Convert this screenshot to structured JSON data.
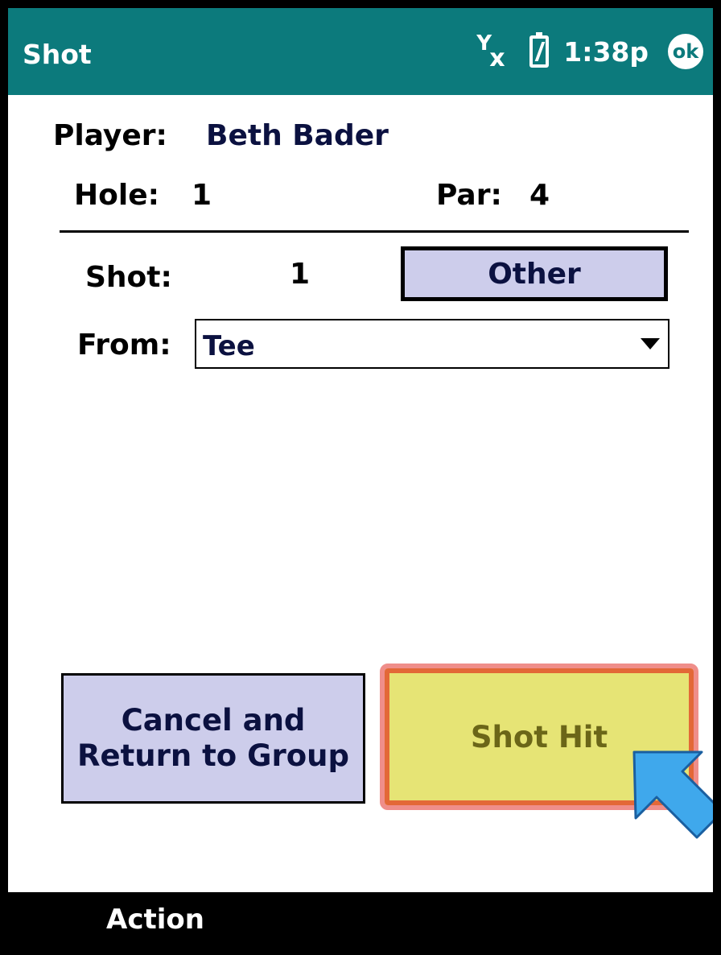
{
  "titlebar": {
    "title": "Shot",
    "time": "1:38p",
    "ok_label": "ok",
    "signal_glyph": "Y",
    "signal_x_glyph": "x"
  },
  "player": {
    "label": "Player:",
    "value": "Beth Bader"
  },
  "hole": {
    "label": "Hole:",
    "value": "1"
  },
  "par": {
    "label": "Par:",
    "value": "4"
  },
  "shot": {
    "label": "Shot:",
    "value": "1",
    "other_button": "Other"
  },
  "from": {
    "label": "From:",
    "value": "Tee"
  },
  "buttons": {
    "cancel_line1": "Cancel and",
    "cancel_line2": "Return to Group",
    "shot_hit": "Shot Hit"
  },
  "menu": {
    "action": "Action"
  },
  "colors": {
    "titlebar": "#0c7a7c",
    "button_lavender": "#cdcdeb",
    "shot_hit_fill": "#e6e475",
    "highlight_border": "#ef8e8a",
    "pointer_arrow": "#3fa8ec"
  },
  "icons": {
    "signal": "signal-off-icon",
    "battery": "battery-icon",
    "ok": "ok-icon",
    "dropdown": "chevron-down-icon",
    "pointer": "pointer-arrow-icon"
  }
}
